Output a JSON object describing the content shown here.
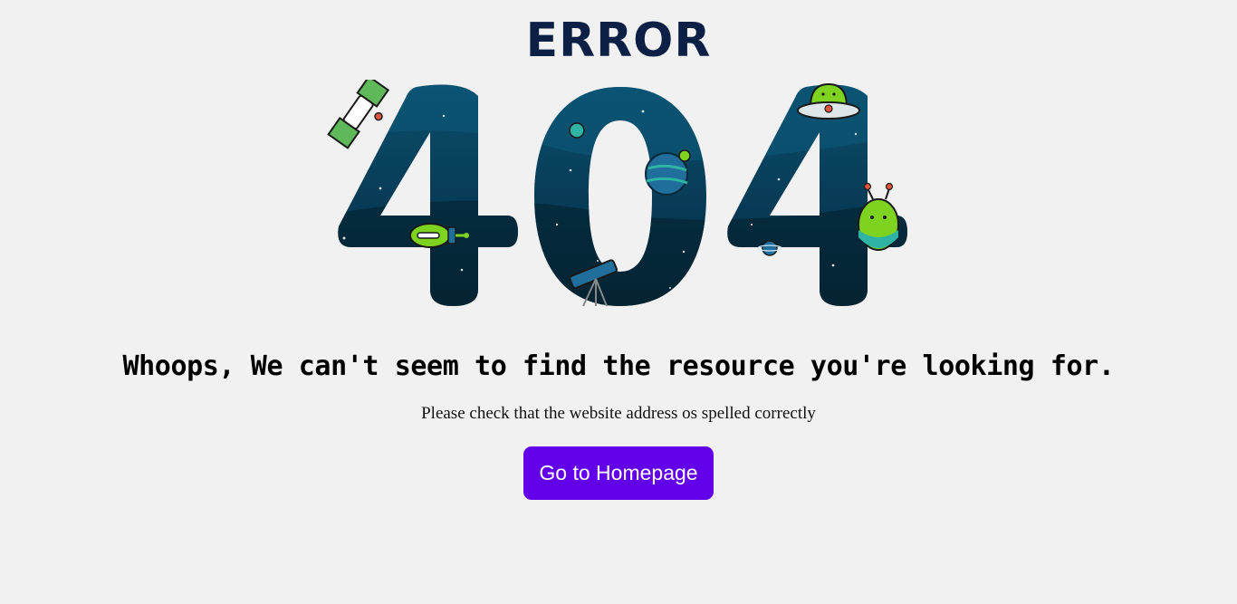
{
  "header": {
    "title": "ERROR"
  },
  "illustration": {
    "code": "404",
    "icons": [
      "satellite-icon",
      "rocket-icon",
      "planet-icon",
      "telescope-icon",
      "ufo-icon",
      "alien-icon",
      "small-planet-icon"
    ],
    "colors": {
      "space_dark": "#062c43",
      "space_light": "#0b4f6c",
      "alien_green": "#7ed321"
    }
  },
  "main": {
    "headline": "Whoops, We can't seem to find the resource you're looking for.",
    "subtext": "Please check that the website address os spelled correctly",
    "button_label": "Go to Homepage"
  },
  "colors": {
    "background": "#f1f1f1",
    "title": "#0c1f45",
    "button": "#6200ea"
  }
}
